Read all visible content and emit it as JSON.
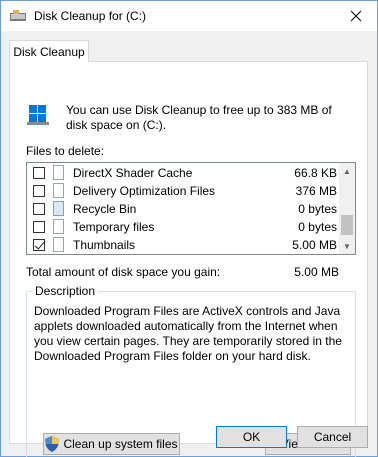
{
  "window": {
    "title": "Disk Cleanup for  (C:)"
  },
  "tab": {
    "label": "Disk Cleanup"
  },
  "intro": {
    "text": "You can use Disk Cleanup to free up to 383 MB of disk space on  (C:)."
  },
  "files": {
    "label": "Files to delete:",
    "items": [
      {
        "label": "DirectX Shader Cache",
        "size": "66.8 KB",
        "checked": false,
        "icon": "file-icon"
      },
      {
        "label": "Delivery Optimization Files",
        "size": "376 MB",
        "checked": false,
        "icon": "file-icon"
      },
      {
        "label": "Recycle Bin",
        "size": "0 bytes",
        "checked": false,
        "icon": "recycle-bin-icon"
      },
      {
        "label": "Temporary files",
        "size": "0 bytes",
        "checked": false,
        "icon": "file-icon"
      },
      {
        "label": "Thumbnails",
        "size": "5.00 MB",
        "checked": true,
        "icon": "file-icon"
      }
    ]
  },
  "total": {
    "label": "Total amount of disk space you gain:",
    "value": "5.00 MB"
  },
  "description": {
    "legend": "Description",
    "text": "Downloaded Program Files are ActiveX controls and Java applets downloaded automatically from the Internet when you view certain pages. They are temporarily stored in the Downloaded Program Files folder on your hard disk."
  },
  "buttons": {
    "cleanup_system": "Clean up system files",
    "view_files": "View Files",
    "ok": "OK",
    "cancel": "Cancel"
  }
}
